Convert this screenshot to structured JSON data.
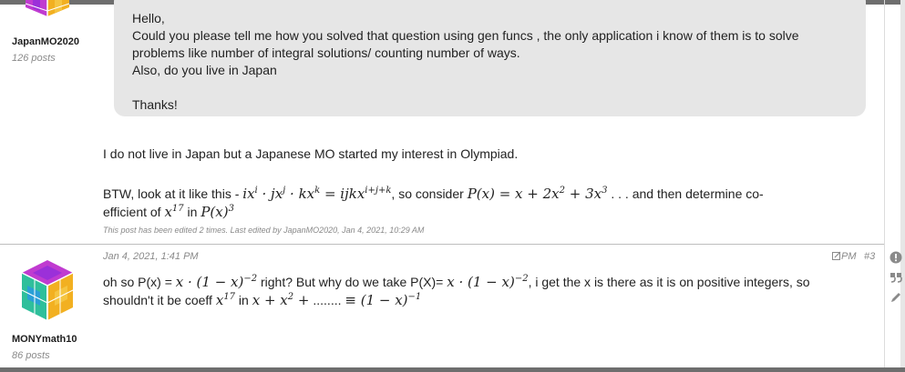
{
  "posts": {
    "first": {
      "username": "JapanMO2020",
      "post_count": "126 posts",
      "quote_lines": [
        "Hello,",
        "Could you please tell me how you solved that question using gen funcs , the only application i know of them is to solve",
        "problems like number of integral solutions/ counting number of ways.",
        "Also, do you live in Japan",
        "",
        "Thanks!"
      ],
      "reply_line1": "I do not live in Japan but a Japanese MO started my interest in Olympiad.",
      "reply_btw_prefix": "BTW, look at it like this - ",
      "reply_btw_middle": ", so consider ",
      "reply_btw_suffix": " . . . and then determine co-",
      "reply_efficient_prefix": "efficient of ",
      "reply_efficient_middle": " in ",
      "edited_note": "This post has been edited 2 times. Last edited by JapanMO2020, Jan 4, 2021, 10:29 AM"
    },
    "second": {
      "username": "MONYmath10",
      "post_count": "86 posts",
      "date": "Jan 4, 2021, 1:41 PM",
      "pm_label": "PM",
      "post_number": "#3",
      "line1_prefix": "oh so P(x) = ",
      "line1_middle": " right? But why do we take P(X)= ",
      "line1_suffix": ", i get the x is there as it is on positive integers, so",
      "line2_prefix": "shouldn't it be coeff ",
      "line2_middle": " in ",
      "line2_dots": " ........ "
    }
  },
  "icons": [
    "user-avatar-cube",
    "pm-edit-icon",
    "report-icon",
    "quote-icon",
    "edit-pencil-icon"
  ],
  "colors": {
    "quote_bg": "#e6e6e6",
    "muted": "#8a8a8a"
  }
}
